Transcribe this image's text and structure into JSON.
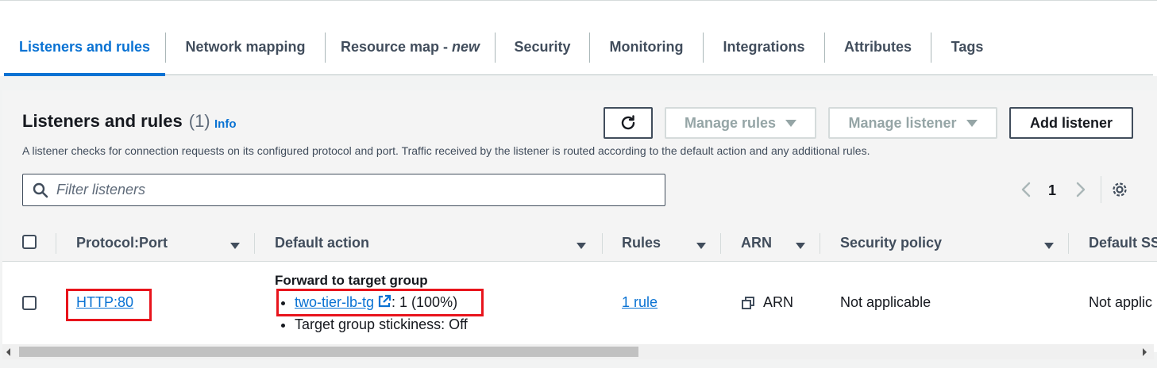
{
  "tabs": [
    {
      "label": "Listeners and rules",
      "active": true
    },
    {
      "label": "Network mapping"
    },
    {
      "label": "Resource map - ",
      "suffix": "new"
    },
    {
      "label": "Security"
    },
    {
      "label": "Monitoring"
    },
    {
      "label": "Integrations"
    },
    {
      "label": "Attributes"
    },
    {
      "label": "Tags"
    }
  ],
  "panel": {
    "title": "Listeners and rules",
    "count": "(1)",
    "info": "Info",
    "description": "A listener checks for connection requests on its configured protocol and port. Traffic received by the listener is routed according to the default action and any additional rules.",
    "buttons": {
      "manage_rules": "Manage rules",
      "manage_listener": "Manage listener",
      "add_listener": "Add listener"
    },
    "filter_placeholder": "Filter listeners",
    "page": "1"
  },
  "table": {
    "columns": [
      "Protocol:Port",
      "Default action",
      "Rules",
      "ARN",
      "Security policy",
      "Default SS"
    ],
    "rows": [
      {
        "protocol_port": "HTTP:80",
        "default_action_title": "Forward to target group",
        "target_group": "two-tier-lb-tg",
        "target_weight": ": 1 (100%)",
        "stickiness": "Target group stickiness: Off",
        "rules": "1 rule",
        "arn": "ARN",
        "security_policy": "Not applicable",
        "default_ssl": "Not applic"
      }
    ]
  },
  "colors": {
    "accent": "#0972d3",
    "highlight": "#e8141c"
  },
  "icons": [
    "refresh-icon",
    "search-icon",
    "chevron-left-icon",
    "chevron-right-icon",
    "gear-icon",
    "sort-caret-icon",
    "external-link-icon",
    "copy-icon"
  ]
}
